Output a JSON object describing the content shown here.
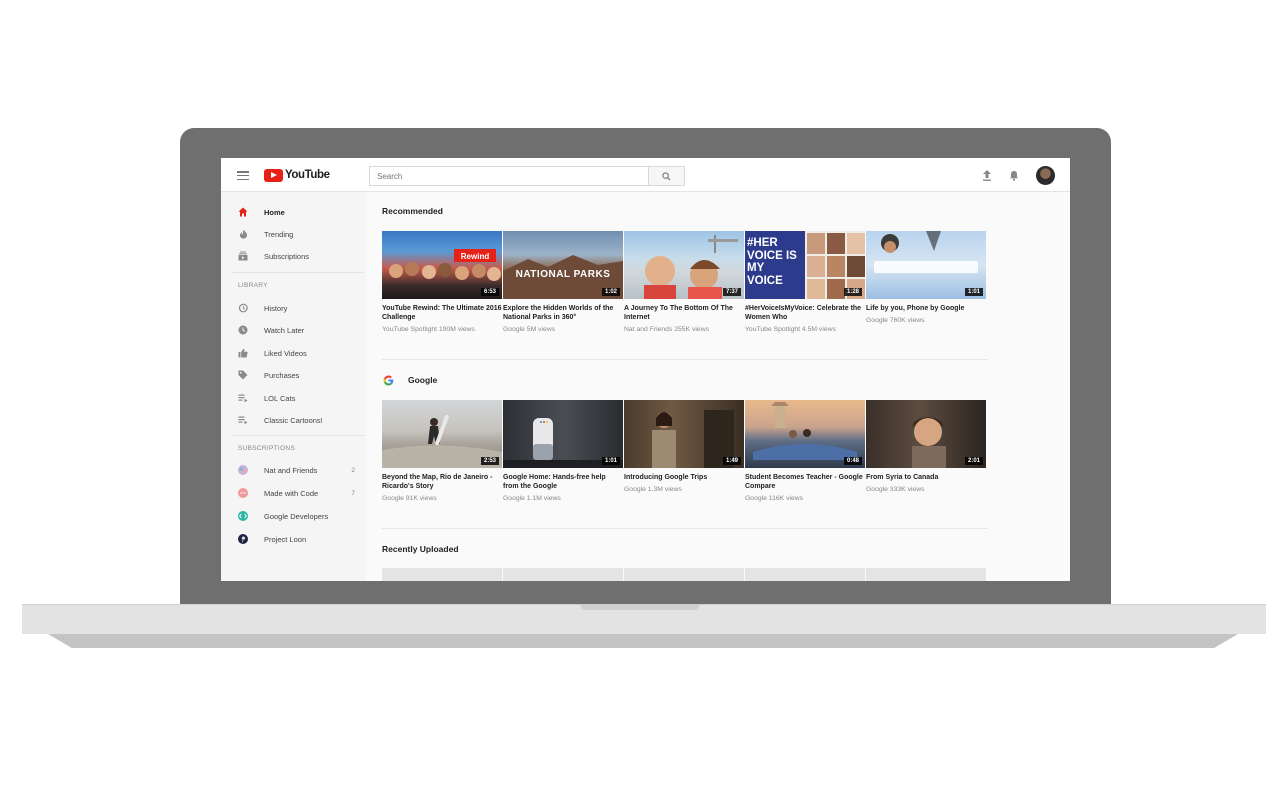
{
  "header": {
    "logo_text": "YouTube",
    "search_placeholder": "Search"
  },
  "sidebar": {
    "main_items": [
      {
        "label": "Home",
        "icon": "home-icon"
      },
      {
        "label": "Trending",
        "icon": "flame-icon"
      },
      {
        "label": "Subscriptions",
        "icon": "subscriptions-icon"
      }
    ],
    "library_title": "LIBRARY",
    "library_items": [
      {
        "label": "History",
        "icon": "history-icon"
      },
      {
        "label": "Watch Later",
        "icon": "clock-icon"
      },
      {
        "label": "Liked Videos",
        "icon": "thumbs-up-icon"
      },
      {
        "label": "Purchases",
        "icon": "tag-icon"
      },
      {
        "label": "LOL Cats",
        "icon": "playlist-icon"
      },
      {
        "label": "Classic Cartoons!",
        "icon": "playlist-icon"
      }
    ],
    "subscriptions_title": "SUBSCRIPTIONS",
    "subscription_items": [
      {
        "label": "Nat and Friends",
        "count": "2"
      },
      {
        "label": "Made with Code",
        "count": "7"
      },
      {
        "label": "Google Developers",
        "count": ""
      },
      {
        "label": "Project Loon",
        "count": ""
      }
    ]
  },
  "shelves": {
    "recommended": {
      "title": "Recommended",
      "videos": [
        {
          "title": "YouTube Rewind: The Ultimate 2016 Challenge",
          "meta": "YouTube Spotlight   190M views",
          "duration": "6:53"
        },
        {
          "title": "Explore the Hidden Worlds of the National Parks in 360°",
          "meta": "Google   5M views",
          "duration": "1:02",
          "overlay": "NATIONAL PARKS"
        },
        {
          "title": "A Journey To The Bottom Of The Internet",
          "meta": "Nat and Friends   255K views",
          "duration": "7:37"
        },
        {
          "title": "#HerVoiceIsMyVoice: Celebrate the Women Who",
          "meta": "YouTube Spotlight   4.5M views",
          "duration": "1:28",
          "overlay": "#HER VOICE IS MY VOICE"
        },
        {
          "title": "Life by you, Phone by Google",
          "meta": "Google   760K views",
          "duration": "1:01"
        }
      ]
    },
    "google": {
      "title": "Google",
      "videos": [
        {
          "title": "Beyond the Map, Rio de Janeiro - Ricardo's Story",
          "meta": "Google   91K views",
          "duration": "2:53"
        },
        {
          "title": "Google Home: Hands-free help from the Google",
          "meta": "Google   1.1M views",
          "duration": "1:01"
        },
        {
          "title": "Introducing Google Trips",
          "meta": "Google   1.3M views",
          "duration": "1:49"
        },
        {
          "title": "Student Becomes Teacher - Google Compare",
          "meta": "Google   116K views",
          "duration": "0:48"
        },
        {
          "title": "From Syria to Canada",
          "meta": "Google   333K views",
          "duration": "2:01"
        }
      ]
    },
    "recent": {
      "title": "Recently Uploaded"
    }
  },
  "colors": {
    "brand_red": "#e62117",
    "frame_gray": "#6f6f6f"
  }
}
